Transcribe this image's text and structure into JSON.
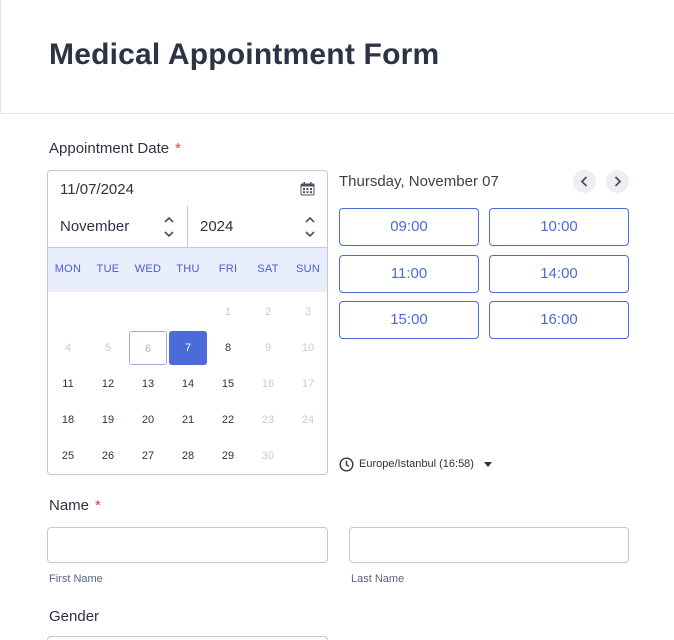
{
  "form": {
    "title": "Medical Appointment Form"
  },
  "appointment": {
    "label": "Appointment Date",
    "required_mark": "*",
    "date_value": "11/07/2024",
    "month": "November",
    "year": "2024",
    "weekdays": [
      "MON",
      "TUE",
      "WED",
      "THU",
      "FRI",
      "SAT",
      "SUN"
    ],
    "weeks": [
      [
        {
          "d": ""
        },
        {
          "d": ""
        },
        {
          "d": ""
        },
        {
          "d": ""
        },
        {
          "d": "1",
          "s": "muted"
        },
        {
          "d": "2",
          "s": "muted"
        },
        {
          "d": "3",
          "s": "muted"
        }
      ],
      [
        {
          "d": "4",
          "s": "muted"
        },
        {
          "d": "5",
          "s": "muted"
        },
        {
          "d": "6",
          "s": "today"
        },
        {
          "d": "7",
          "s": "selected"
        },
        {
          "d": "8"
        },
        {
          "d": "9",
          "s": "muted"
        },
        {
          "d": "10",
          "s": "muted"
        }
      ],
      [
        {
          "d": "11"
        },
        {
          "d": "12"
        },
        {
          "d": "13"
        },
        {
          "d": "14"
        },
        {
          "d": "15"
        },
        {
          "d": "16",
          "s": "muted"
        },
        {
          "d": "17",
          "s": "muted"
        }
      ],
      [
        {
          "d": "18"
        },
        {
          "d": "19"
        },
        {
          "d": "20"
        },
        {
          "d": "21"
        },
        {
          "d": "22"
        },
        {
          "d": "23",
          "s": "muted"
        },
        {
          "d": "24",
          "s": "muted"
        }
      ],
      [
        {
          "d": "25"
        },
        {
          "d": "26"
        },
        {
          "d": "27"
        },
        {
          "d": "28"
        },
        {
          "d": "29"
        },
        {
          "d": "30",
          "s": "muted"
        },
        {
          "d": ""
        }
      ]
    ],
    "slot_date": "Thursday, November 07",
    "time_slots": [
      "09:00",
      "10:00",
      "11:00",
      "14:00",
      "15:00",
      "16:00"
    ],
    "timezone": "Europe/Istanbul (16:58)",
    "icons": {
      "calendar": "calendar-icon",
      "clock": "clock-icon",
      "prev": "chevron-left-icon",
      "next": "chevron-right-icon"
    }
  },
  "name": {
    "label": "Name",
    "required_mark": "*",
    "first_name_value": "",
    "last_name_value": "",
    "first_sublabel": "First Name",
    "last_sublabel": "Last Name"
  },
  "gender": {
    "label": "Gender"
  },
  "colors": {
    "accent": "#4d6ad9",
    "required": "#f23a3c",
    "weekday_bg": "#e8eefb",
    "text": "#2c3345"
  }
}
